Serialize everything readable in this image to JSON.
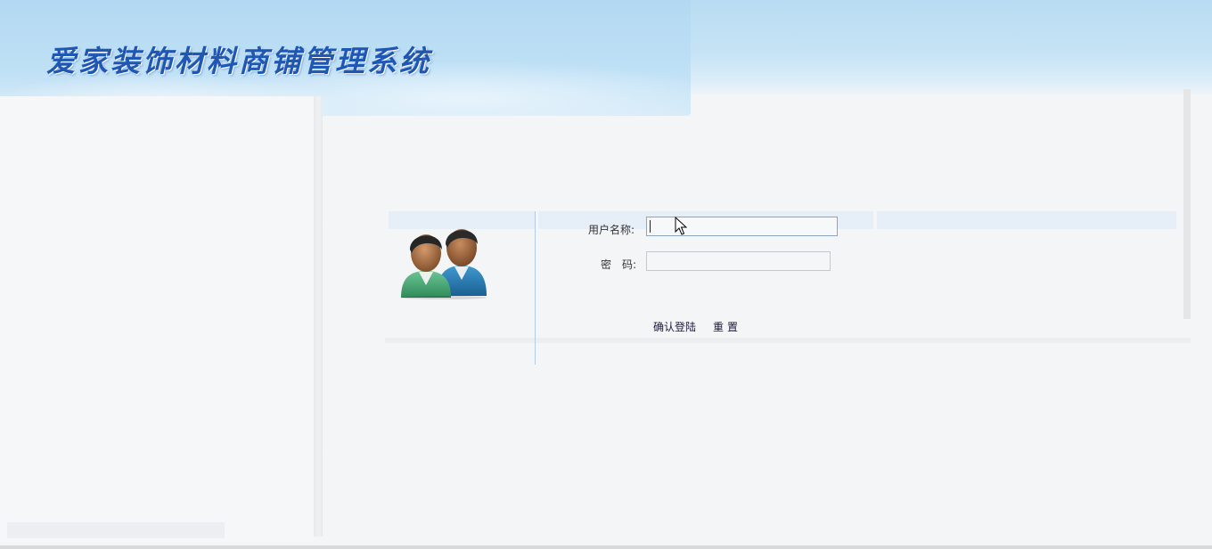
{
  "header": {
    "title": "爱家装饰材料商铺管理系统",
    "title_color": "#1f58b4"
  },
  "login": {
    "username_label": "用户名称:",
    "password_label_left": "密",
    "password_label_right": "码:",
    "username_value": "",
    "password_value": "",
    "submit_label": "确认登陆",
    "reset_label": "重置",
    "avatar_icon": "users-icon"
  },
  "colors": {
    "header_sky": "#b9dcf2",
    "background": "#f4f5f7",
    "separator": "#b4cde4"
  }
}
